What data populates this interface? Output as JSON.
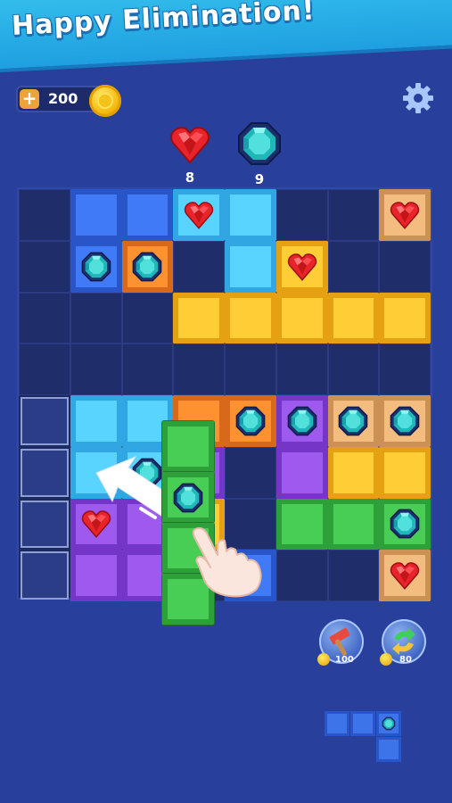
{
  "title": "Happy Elimination!",
  "coins": {
    "value": "200"
  },
  "goals": [
    {
      "gem": "red-heart-gem",
      "count": "8"
    },
    {
      "gem": "teal-octagon-gem",
      "count": "9"
    }
  ],
  "boosters": [
    {
      "name": "hammer",
      "price": "100"
    },
    {
      "name": "refresh",
      "price": "80"
    }
  ],
  "board": {
    "cols": 8,
    "rows": 8,
    "cells": [
      [
        "empty",
        "blue",
        "blue",
        "lblue:heart",
        "lblue",
        "empty",
        "empty",
        "tan:heart"
      ],
      [
        "empty",
        "blue:octagon",
        "orange:octagon",
        "empty",
        "lblue",
        "yellow:heart",
        "empty",
        "empty"
      ],
      [
        "empty",
        "empty",
        "empty",
        "yellow",
        "yellow",
        "yellow",
        "yellow",
        "yellow"
      ],
      [
        "empty",
        "empty",
        "empty",
        "empty",
        "empty",
        "empty",
        "empty",
        "empty"
      ],
      [
        "outline",
        "lblue",
        "lblue",
        "orange",
        "orange:octagon",
        "purple:octagon",
        "tan:octagon",
        "tan:octagon"
      ],
      [
        "outline",
        "lblue",
        "lblue:octagon",
        "purple",
        "empty",
        "purple",
        "yellow",
        "yellow"
      ],
      [
        "outline",
        "purple:heart",
        "purple",
        "yellow",
        "empty",
        "green",
        "green",
        "green:octagon"
      ],
      [
        "outline",
        "purple",
        "purple",
        "empty",
        "blue",
        "empty",
        "empty",
        "tan:heart"
      ]
    ]
  },
  "dragging_piece": {
    "color": "green",
    "cells": [
      "plain",
      "octagon",
      "plain",
      "plain"
    ]
  },
  "next_piece": {
    "color": "blue",
    "shape": "L"
  },
  "colors": {
    "background": "#283f9b",
    "banner": "#2aaee8",
    "heart": "#e8242a",
    "octagon": "#22b7b7"
  }
}
